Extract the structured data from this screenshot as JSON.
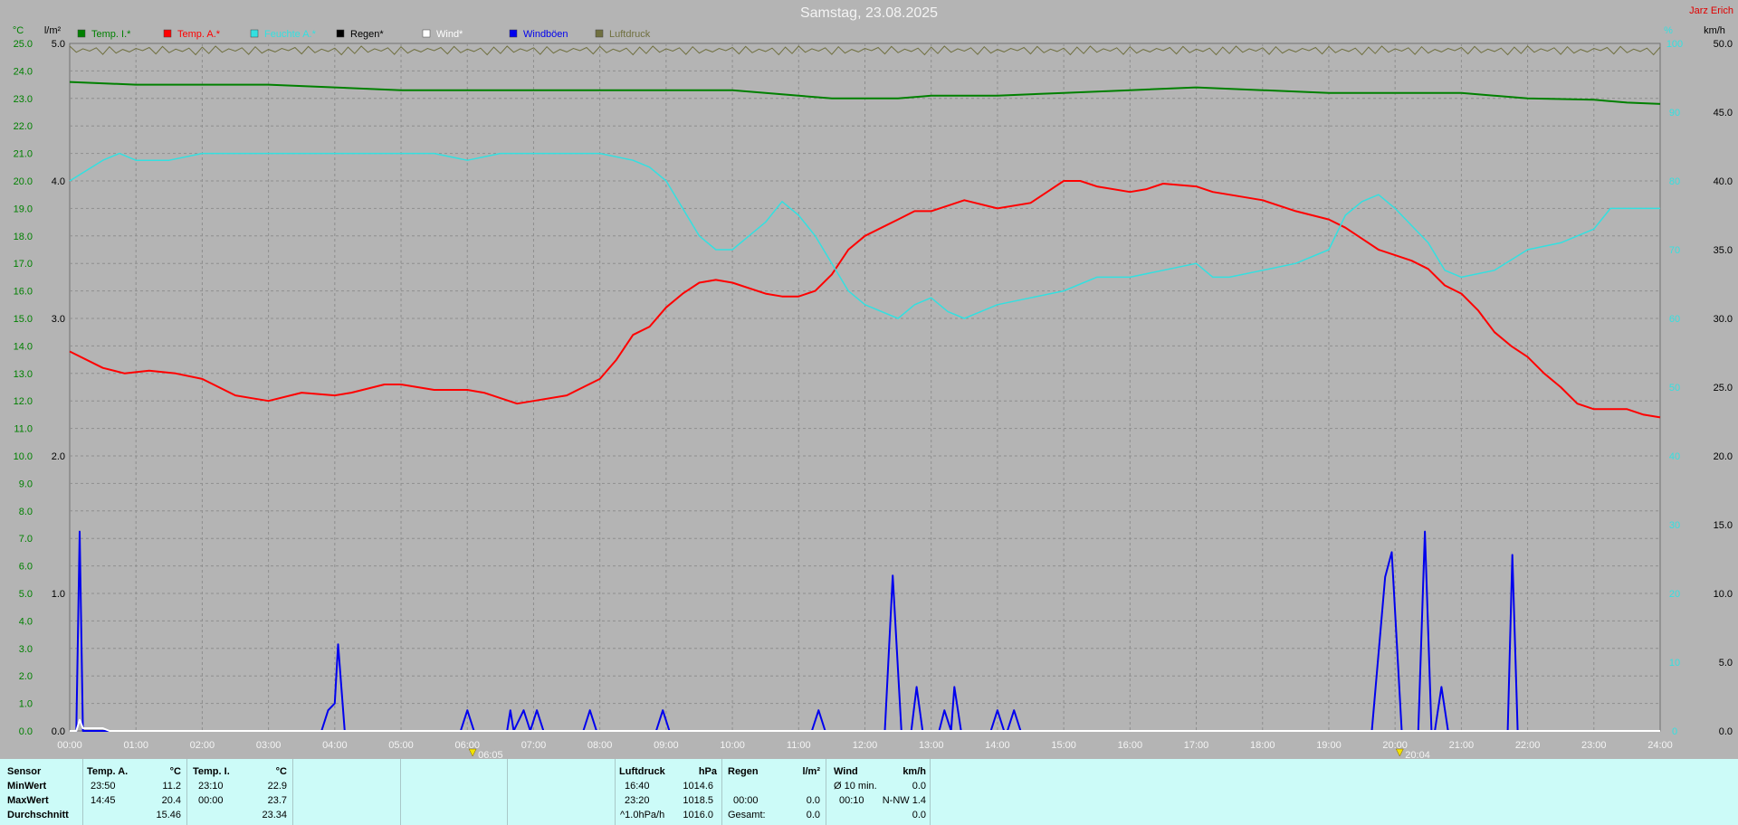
{
  "title": "Samstag, 23.08.2025",
  "author": "Jarz Erich",
  "units": {
    "left1": "°C",
    "left2": "l/m²",
    "right1": "%",
    "right2": "km/h"
  },
  "legend": [
    {
      "label": "Temp. I.*",
      "color": "#008000"
    },
    {
      "label": "Temp. A.*",
      "color": "#ff0000"
    },
    {
      "label": "Feuchte A.*",
      "color": "#33e0e0"
    },
    {
      "label": "Regen*",
      "color": "#000000"
    },
    {
      "label": "Wind*",
      "color": "#ffffff"
    },
    {
      "label": "Windböen",
      "color": "#0000ee"
    },
    {
      "label": "Luftdruck",
      "color": "#707040"
    }
  ],
  "colors": {
    "temp_axis": "#008000",
    "hum_axis": "#33e0e0",
    "grid": "#8e8e8e"
  },
  "chart_data": {
    "type": "line",
    "x_unit": "hour",
    "xlim": [
      0,
      24
    ],
    "x_ticks": [
      "00:00",
      "01:00",
      "02:00",
      "03:00",
      "04:00",
      "05:00",
      "06:00",
      "07:00",
      "08:00",
      "09:00",
      "10:00",
      "11:00",
      "12:00",
      "13:00",
      "14:00",
      "15:00",
      "16:00",
      "17:00",
      "18:00",
      "19:00",
      "20:00",
      "21:00",
      "22:00",
      "23:00",
      "24:00"
    ],
    "temp_axis": {
      "ylim": [
        0,
        25
      ],
      "ticks": [
        "0.0",
        "1.0",
        "2.0",
        "3.0",
        "4.0",
        "5.0",
        "6.0",
        "7.0",
        "8.0",
        "9.0",
        "10.0",
        "11.0",
        "12.0",
        "13.0",
        "14.0",
        "15.0",
        "16.0",
        "17.0",
        "18.0",
        "19.0",
        "20.0",
        "21.0",
        "22.0",
        "23.0",
        "24.0",
        "25.0"
      ]
    },
    "rain_axis": {
      "ylim": [
        0,
        5
      ],
      "ticks": [
        "0.0",
        "1.0",
        "2.0",
        "3.0",
        "4.0",
        "5.0"
      ]
    },
    "humidity_axis": {
      "ylim": [
        0,
        100
      ],
      "ticks": [
        "0",
        "10",
        "20",
        "30",
        "40",
        "50",
        "60",
        "70",
        "80",
        "90",
        "100"
      ]
    },
    "wind_axis": {
      "ylim": [
        0,
        50
      ],
      "ticks": [
        "0.0",
        "5.0",
        "10.0",
        "15.0",
        "20.0",
        "25.0",
        "30.0",
        "35.0",
        "40.0",
        "45.0",
        "50.0"
      ]
    },
    "series": [
      {
        "name": "Temp. I.*",
        "axis": "temp",
        "color": "#008000",
        "points": [
          [
            0,
            23.6
          ],
          [
            1,
            23.5
          ],
          [
            2,
            23.5
          ],
          [
            3,
            23.5
          ],
          [
            4,
            23.4
          ],
          [
            5,
            23.3
          ],
          [
            6,
            23.3
          ],
          [
            7,
            23.3
          ],
          [
            8,
            23.3
          ],
          [
            9,
            23.3
          ],
          [
            10,
            23.3
          ],
          [
            11,
            23.1
          ],
          [
            11.5,
            23.0
          ],
          [
            12,
            23.0
          ],
          [
            12.5,
            23.0
          ],
          [
            13,
            23.1
          ],
          [
            14,
            23.1
          ],
          [
            15,
            23.2
          ],
          [
            16,
            23.3
          ],
          [
            17,
            23.4
          ],
          [
            18,
            23.3
          ],
          [
            19,
            23.2
          ],
          [
            20,
            23.2
          ],
          [
            21,
            23.2
          ],
          [
            22,
            23.0
          ],
          [
            23,
            22.95
          ],
          [
            23.5,
            22.85
          ],
          [
            24,
            22.8
          ]
        ]
      },
      {
        "name": "Temp. A.*",
        "axis": "temp",
        "color": "#ff0000",
        "points": [
          [
            0,
            13.8
          ],
          [
            0.5,
            13.2
          ],
          [
            0.83,
            13.0
          ],
          [
            1.2,
            13.1
          ],
          [
            1.6,
            13.0
          ],
          [
            2,
            12.8
          ],
          [
            2.5,
            12.2
          ],
          [
            2.75,
            12.1
          ],
          [
            3,
            12.0
          ],
          [
            3.5,
            12.3
          ],
          [
            4,
            12.2
          ],
          [
            4.25,
            12.3
          ],
          [
            4.75,
            12.6
          ],
          [
            5,
            12.6
          ],
          [
            5.5,
            12.4
          ],
          [
            6,
            12.4
          ],
          [
            6.25,
            12.3
          ],
          [
            6.75,
            11.9
          ],
          [
            7,
            12.0
          ],
          [
            7.5,
            12.2
          ],
          [
            8,
            12.8
          ],
          [
            8.25,
            13.5
          ],
          [
            8.5,
            14.4
          ],
          [
            8.75,
            14.7
          ],
          [
            9,
            15.4
          ],
          [
            9.25,
            15.9
          ],
          [
            9.5,
            16.3
          ],
          [
            9.75,
            16.4
          ],
          [
            10,
            16.3
          ],
          [
            10.5,
            15.9
          ],
          [
            10.75,
            15.8
          ],
          [
            11,
            15.8
          ],
          [
            11.25,
            16.0
          ],
          [
            11.5,
            16.6
          ],
          [
            11.75,
            17.5
          ],
          [
            12,
            18.0
          ],
          [
            12.25,
            18.3
          ],
          [
            12.5,
            18.6
          ],
          [
            12.75,
            18.9
          ],
          [
            13,
            18.9
          ],
          [
            13.25,
            19.1
          ],
          [
            13.5,
            19.3
          ],
          [
            14,
            19.0
          ],
          [
            14.5,
            19.2
          ],
          [
            14.75,
            19.6
          ],
          [
            15,
            20.0
          ],
          [
            15.25,
            20.0
          ],
          [
            15.5,
            19.8
          ],
          [
            16,
            19.6
          ],
          [
            16.25,
            19.7
          ],
          [
            16.5,
            19.9
          ],
          [
            17,
            19.8
          ],
          [
            17.25,
            19.6
          ],
          [
            17.5,
            19.5
          ],
          [
            18,
            19.3
          ],
          [
            18.5,
            18.9
          ],
          [
            19,
            18.6
          ],
          [
            19.25,
            18.3
          ],
          [
            19.5,
            17.9
          ],
          [
            19.75,
            17.5
          ],
          [
            20,
            17.3
          ],
          [
            20.25,
            17.1
          ],
          [
            20.5,
            16.8
          ],
          [
            20.75,
            16.2
          ],
          [
            21,
            15.9
          ],
          [
            21.25,
            15.3
          ],
          [
            21.5,
            14.5
          ],
          [
            21.75,
            14.0
          ],
          [
            22,
            13.6
          ],
          [
            22.25,
            13.0
          ],
          [
            22.5,
            12.5
          ],
          [
            22.75,
            11.9
          ],
          [
            23,
            11.7
          ],
          [
            23.25,
            11.7
          ],
          [
            23.5,
            11.7
          ],
          [
            23.75,
            11.5
          ],
          [
            24,
            11.4
          ]
        ]
      },
      {
        "name": "Feuchte A.*",
        "axis": "humidity",
        "color": "#33e0e0",
        "points": [
          [
            0,
            80
          ],
          [
            0.5,
            83
          ],
          [
            0.75,
            84
          ],
          [
            1,
            83
          ],
          [
            1.5,
            83
          ],
          [
            2,
            84
          ],
          [
            2.5,
            84
          ],
          [
            3,
            84
          ],
          [
            3.5,
            84
          ],
          [
            4,
            84
          ],
          [
            5,
            84
          ],
          [
            5.5,
            84
          ],
          [
            6,
            83
          ],
          [
            6.5,
            84
          ],
          [
            7,
            84
          ],
          [
            7.5,
            84
          ],
          [
            8,
            84
          ],
          [
            8.5,
            83
          ],
          [
            8.75,
            82
          ],
          [
            9,
            80
          ],
          [
            9.25,
            76
          ],
          [
            9.5,
            72
          ],
          [
            9.75,
            70
          ],
          [
            10,
            70
          ],
          [
            10.25,
            72
          ],
          [
            10.5,
            74
          ],
          [
            10.75,
            77
          ],
          [
            11,
            75
          ],
          [
            11.25,
            72
          ],
          [
            11.5,
            68
          ],
          [
            11.75,
            64
          ],
          [
            12,
            62
          ],
          [
            12.5,
            60
          ],
          [
            12.75,
            62
          ],
          [
            13,
            63
          ],
          [
            13.25,
            61
          ],
          [
            13.5,
            60
          ],
          [
            13.75,
            61
          ],
          [
            14,
            62
          ],
          [
            14.5,
            63
          ],
          [
            15,
            64
          ],
          [
            15.25,
            65
          ],
          [
            15.5,
            66
          ],
          [
            16,
            66
          ],
          [
            16.5,
            67
          ],
          [
            17,
            68
          ],
          [
            17.25,
            66
          ],
          [
            17.5,
            66
          ],
          [
            18,
            67
          ],
          [
            18.5,
            68
          ],
          [
            19,
            70
          ],
          [
            19.25,
            75
          ],
          [
            19.5,
            77
          ],
          [
            19.75,
            78
          ],
          [
            20,
            76
          ],
          [
            20.5,
            71
          ],
          [
            20.75,
            67
          ],
          [
            21,
            66
          ],
          [
            21.5,
            67
          ],
          [
            22,
            70
          ],
          [
            22.5,
            71
          ],
          [
            23,
            73
          ],
          [
            23.25,
            76
          ],
          [
            23.5,
            76
          ],
          [
            24,
            76
          ]
        ]
      },
      {
        "name": "Windböen",
        "axis": "wind",
        "color": "#0000ee",
        "points": [
          [
            0,
            0
          ],
          [
            0.1,
            0
          ],
          [
            0.15,
            14.5
          ],
          [
            0.2,
            0
          ],
          [
            3.8,
            0
          ],
          [
            3.9,
            1.5
          ],
          [
            4,
            2
          ],
          [
            4.05,
            6.3
          ],
          [
            4.15,
            0
          ],
          [
            5.9,
            0
          ],
          [
            6,
            1.5
          ],
          [
            6.1,
            0
          ],
          [
            6.6,
            0
          ],
          [
            6.65,
            1.5
          ],
          [
            6.7,
            0
          ],
          [
            6.85,
            1.5
          ],
          [
            6.95,
            0
          ],
          [
            7.05,
            1.5
          ],
          [
            7.15,
            0
          ],
          [
            7.75,
            0
          ],
          [
            7.85,
            1.5
          ],
          [
            7.95,
            0
          ],
          [
            8.85,
            0
          ],
          [
            8.95,
            1.5
          ],
          [
            9.05,
            0
          ],
          [
            11.2,
            0
          ],
          [
            11.3,
            1.5
          ],
          [
            11.4,
            0
          ],
          [
            12.3,
            0
          ],
          [
            12.42,
            11.3
          ],
          [
            12.55,
            0
          ],
          [
            12.7,
            0
          ],
          [
            12.78,
            3.2
          ],
          [
            12.87,
            0
          ],
          [
            13.12,
            0
          ],
          [
            13.2,
            1.5
          ],
          [
            13.3,
            0
          ],
          [
            13.35,
            3.2
          ],
          [
            13.45,
            0
          ],
          [
            13.9,
            0
          ],
          [
            14,
            1.5
          ],
          [
            14.1,
            0
          ],
          [
            14.15,
            0
          ],
          [
            14.25,
            1.5
          ],
          [
            14.35,
            0
          ],
          [
            19.65,
            0
          ],
          [
            19.85,
            11.2
          ],
          [
            19.95,
            13
          ],
          [
            20.1,
            0
          ],
          [
            20.35,
            0
          ],
          [
            20.45,
            14.5
          ],
          [
            20.55,
            0
          ],
          [
            20.6,
            0
          ],
          [
            20.7,
            3.2
          ],
          [
            20.8,
            0
          ],
          [
            21.7,
            0
          ],
          [
            21.77,
            12.8
          ],
          [
            21.85,
            0
          ],
          [
            24,
            0
          ]
        ]
      },
      {
        "name": "Wind*",
        "axis": "wind",
        "color": "#ffffff",
        "points": [
          [
            0,
            0
          ],
          [
            0.1,
            0
          ],
          [
            0.15,
            0.8
          ],
          [
            0.2,
            0.2
          ],
          [
            0.5,
            0.2
          ],
          [
            0.6,
            0
          ],
          [
            24,
            0
          ]
        ]
      }
    ],
    "events": [
      {
        "label": "06:05",
        "x": 6.08
      },
      {
        "label": "20:04",
        "x": 20.07
      }
    ]
  },
  "stats": {
    "sensor": {
      "title": "Sensor",
      "rows": [
        "MinWert",
        "MaxWert",
        "Durchschnitt"
      ]
    },
    "temp_a": {
      "title": "Temp. A.",
      "unit": "°C",
      "times": [
        "23:50",
        "14:45",
        ""
      ],
      "values": [
        "11.2",
        "20.4",
        "15.46"
      ]
    },
    "temp_i": {
      "title": "Temp. I.",
      "unit": "°C",
      "times": [
        "23:10",
        "00:00",
        ""
      ],
      "values": [
        "22.9",
        "23.7",
        "23.34"
      ]
    },
    "pressure": {
      "title": "Luftdruck",
      "unit": "hPa",
      "times": [
        "16:40",
        "23:20",
        "^1.0hPa/h"
      ],
      "values": [
        "1014.6",
        "1018.5",
        "1016.0"
      ]
    },
    "rain": {
      "title": "Regen",
      "unit": "l/m²",
      "times": [
        "",
        "00:00",
        "Gesamt:"
      ],
      "values": [
        "",
        "0.0",
        "0.0"
      ]
    },
    "wind": {
      "title": "Wind",
      "unit": "km/h",
      "times": [
        "Ø 10 min.",
        "00:10",
        ""
      ],
      "values": [
        "0.0",
        "N-NW 1.4",
        "0.0"
      ]
    }
  }
}
